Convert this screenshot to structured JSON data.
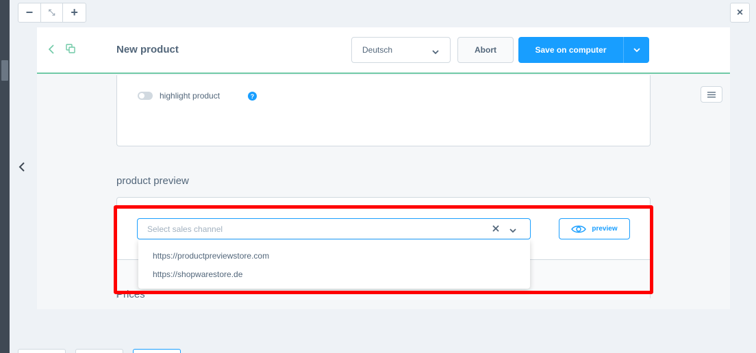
{
  "window": {
    "zoom_out_label": "−",
    "zoom_fit_label": "⤡",
    "zoom_in_label": "+",
    "close_label": "×"
  },
  "header": {
    "title": "New product",
    "language": "Deutsch",
    "abort_label": "Abort",
    "save_label": "Save on computer"
  },
  "highlight": {
    "label": "highlight product",
    "help_label": "?",
    "enabled": false
  },
  "preview_section": {
    "title": "product preview",
    "placeholder": "Select sales channel",
    "button_label": "preview",
    "options": [
      "https://productpreviewstore.com",
      "https://shopwarestore.de"
    ]
  },
  "prices": {
    "title": "Prices"
  },
  "colors": {
    "accent": "#189eff",
    "header_border": "#6fc9a6",
    "annotation": "#ff0000"
  }
}
